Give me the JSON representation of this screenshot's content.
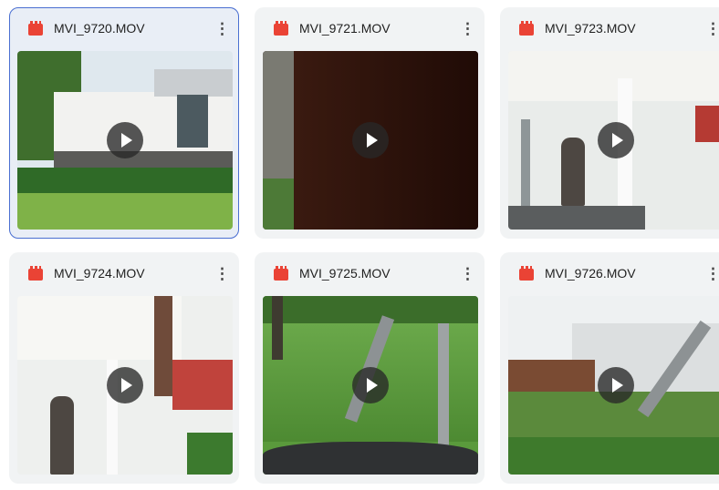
{
  "files": [
    {
      "name": "MVI_9720.MOV",
      "selected": true
    },
    {
      "name": "MVI_9721.MOV",
      "selected": false
    },
    {
      "name": "MVI_9723.MOV",
      "selected": false
    },
    {
      "name": "MVI_9724.MOV",
      "selected": false
    },
    {
      "name": "MVI_9725.MOV",
      "selected": false
    },
    {
      "name": "MVI_9726.MOV",
      "selected": false
    }
  ],
  "icons": {
    "file_type": "video-file-icon",
    "more": "more-vert-icon",
    "play": "play-icon"
  },
  "colors": {
    "video_icon": "#ea4335",
    "selection_border": "#4a6fd1",
    "card_bg": "#f1f3f4"
  },
  "more_glyph": "⋮"
}
